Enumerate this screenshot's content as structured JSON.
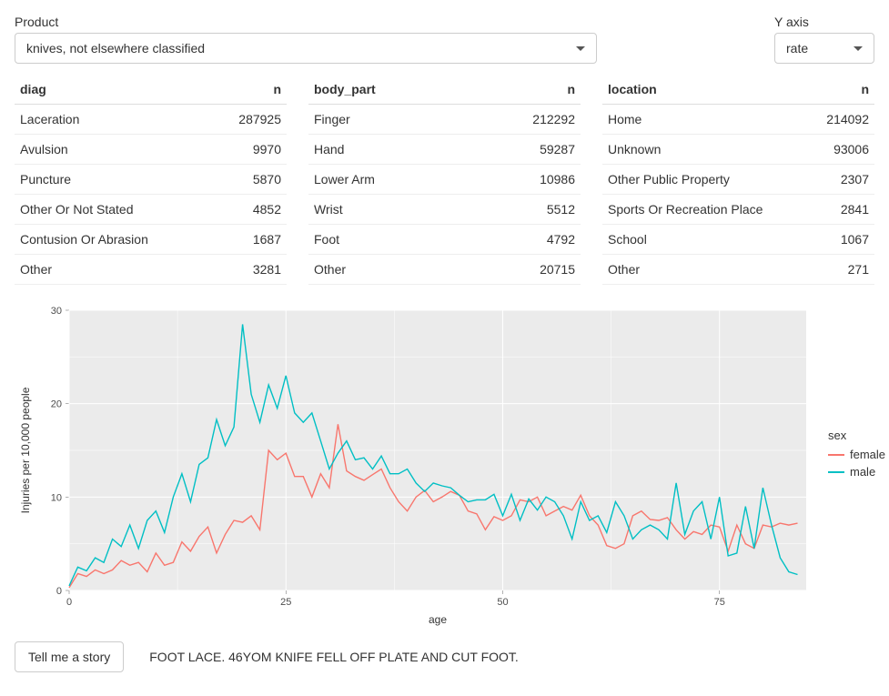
{
  "controls": {
    "product_label": "Product",
    "product_value": "knives, not elsewhere classified",
    "yaxis_label": "Y axis",
    "yaxis_value": "rate"
  },
  "tables": {
    "diag": {
      "col1": "diag",
      "col2": "n",
      "rows": [
        {
          "label": "Laceration",
          "n": "287925"
        },
        {
          "label": "Avulsion",
          "n": "9970"
        },
        {
          "label": "Puncture",
          "n": "5870"
        },
        {
          "label": "Other Or Not Stated",
          "n": "4852"
        },
        {
          "label": "Contusion Or Abrasion",
          "n": "1687"
        },
        {
          "label": "Other",
          "n": "3281"
        }
      ]
    },
    "body_part": {
      "col1": "body_part",
      "col2": "n",
      "rows": [
        {
          "label": "Finger",
          "n": "212292"
        },
        {
          "label": "Hand",
          "n": "59287"
        },
        {
          "label": "Lower Arm",
          "n": "10986"
        },
        {
          "label": "Wrist",
          "n": "5512"
        },
        {
          "label": "Foot",
          "n": "4792"
        },
        {
          "label": "Other",
          "n": "20715"
        }
      ]
    },
    "location": {
      "col1": "location",
      "col2": "n",
      "rows": [
        {
          "label": "Home",
          "n": "214092"
        },
        {
          "label": "Unknown",
          "n": "93006"
        },
        {
          "label": "Other Public Property",
          "n": "2307"
        },
        {
          "label": "Sports Or Recreation Place",
          "n": "2841"
        },
        {
          "label": "School",
          "n": "1067"
        },
        {
          "label": "Other",
          "n": "271"
        }
      ]
    }
  },
  "legend": {
    "title": "sex",
    "items": [
      {
        "label": "female",
        "color": "#F8766D"
      },
      {
        "label": "male",
        "color": "#00BFC4"
      }
    ]
  },
  "story": {
    "button": "Tell me a story",
    "text": "FOOT LACE. 46YOM KNIFE FELL OFF PLATE AND CUT FOOT."
  },
  "chart_data": {
    "type": "line",
    "xlabel": "age",
    "ylabel": "Injuries per 10,000 people",
    "xlim": [
      0,
      85
    ],
    "ylim": [
      0,
      30
    ],
    "xticks": [
      0,
      25,
      50,
      75
    ],
    "yticks": [
      0,
      10,
      20,
      30
    ],
    "series": [
      {
        "name": "female",
        "color": "#F8766D",
        "x": [
          0,
          1,
          2,
          3,
          4,
          5,
          6,
          7,
          8,
          9,
          10,
          11,
          12,
          13,
          14,
          15,
          16,
          17,
          18,
          19,
          20,
          21,
          22,
          23,
          24,
          25,
          26,
          27,
          28,
          29,
          30,
          31,
          32,
          33,
          34,
          35,
          36,
          37,
          38,
          39,
          40,
          41,
          42,
          43,
          44,
          45,
          46,
          47,
          48,
          49,
          50,
          51,
          52,
          53,
          54,
          55,
          56,
          57,
          58,
          59,
          60,
          61,
          62,
          63,
          64,
          65,
          66,
          67,
          68,
          69,
          70,
          71,
          72,
          73,
          74,
          75,
          76,
          77,
          78,
          79,
          80,
          81,
          82,
          83,
          84
        ],
        "y": [
          0.3,
          1.8,
          1.5,
          2.2,
          1.8,
          2.2,
          3.2,
          2.7,
          3.0,
          2.0,
          4.0,
          2.7,
          3.0,
          5.2,
          4.2,
          5.8,
          6.8,
          4.0,
          6.0,
          7.5,
          7.3,
          8.0,
          6.5,
          15.0,
          14.0,
          14.7,
          12.2,
          12.2,
          10.0,
          12.5,
          11.0,
          17.8,
          12.8,
          12.2,
          11.8,
          12.4,
          13.0,
          11.0,
          9.5,
          8.5,
          10.0,
          10.7,
          9.5,
          10.0,
          10.6,
          10.2,
          8.5,
          8.2,
          6.5,
          7.9,
          7.5,
          8.0,
          9.7,
          9.5,
          10.0,
          8.0,
          8.5,
          9.0,
          8.6,
          10.2,
          8.0,
          7.0,
          4.8,
          4.5,
          5.0,
          8.0,
          8.5,
          7.6,
          7.5,
          7.8,
          6.5,
          5.5,
          6.3,
          6.0,
          7.0,
          6.8,
          4.2,
          7.0,
          5.0,
          4.5,
          7.0,
          6.8,
          7.2,
          7.0,
          7.2
        ]
      },
      {
        "name": "male",
        "color": "#00BFC4",
        "x": [
          0,
          1,
          2,
          3,
          4,
          5,
          6,
          7,
          8,
          9,
          10,
          11,
          12,
          13,
          14,
          15,
          16,
          17,
          18,
          19,
          20,
          21,
          22,
          23,
          24,
          25,
          26,
          27,
          28,
          29,
          30,
          31,
          32,
          33,
          34,
          35,
          36,
          37,
          38,
          39,
          40,
          41,
          42,
          43,
          44,
          45,
          46,
          47,
          48,
          49,
          50,
          51,
          52,
          53,
          54,
          55,
          56,
          57,
          58,
          59,
          60,
          61,
          62,
          63,
          64,
          65,
          66,
          67,
          68,
          69,
          70,
          71,
          72,
          73,
          74,
          75,
          76,
          77,
          78,
          79,
          80,
          81,
          82,
          83,
          84
        ],
        "y": [
          0.5,
          2.5,
          2.1,
          3.5,
          3.0,
          5.5,
          4.7,
          7.0,
          4.5,
          7.5,
          8.5,
          6.2,
          10.0,
          12.5,
          9.5,
          13.5,
          14.2,
          18.3,
          15.5,
          17.5,
          28.5,
          21.0,
          18.0,
          22.0,
          19.5,
          23.0,
          19.0,
          18.0,
          19.0,
          16.0,
          13.0,
          14.7,
          16.0,
          14.0,
          14.2,
          13.0,
          14.4,
          12.5,
          12.5,
          13.0,
          11.5,
          10.6,
          11.5,
          11.2,
          11.0,
          10.2,
          9.5,
          9.7,
          9.7,
          10.3,
          8.0,
          10.3,
          7.5,
          9.8,
          8.6,
          10.0,
          9.5,
          8.0,
          5.5,
          9.5,
          7.5,
          8.0,
          6.2,
          9.5,
          8.0,
          5.5,
          6.5,
          7.0,
          6.5,
          5.5,
          11.5,
          6.0,
          8.5,
          9.5,
          5.5,
          10.0,
          3.7,
          4.0,
          9.0,
          4.5,
          11.0,
          7.0,
          3.5,
          2.0,
          1.7
        ]
      }
    ]
  }
}
